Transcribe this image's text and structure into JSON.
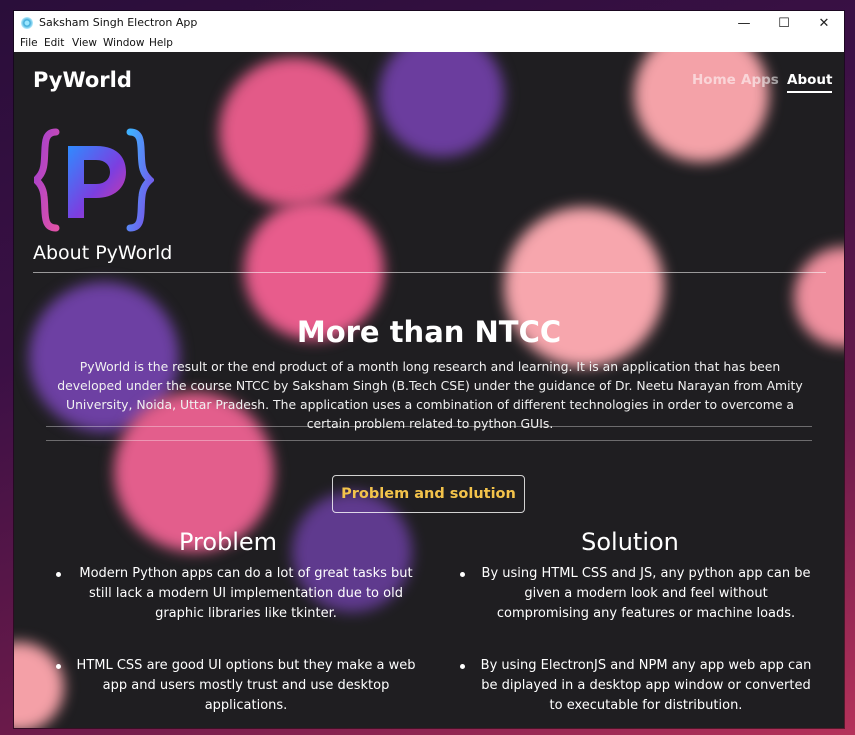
{
  "window": {
    "title": "Saksham Singh Electron App",
    "controls": {
      "minimize": "—",
      "maximize": "☐",
      "close": "✕"
    }
  },
  "menu": [
    "File",
    "Edit",
    "View",
    "Window",
    "Help"
  ],
  "nav": {
    "brand": "PyWorld",
    "links": [
      "Home",
      "Apps",
      "About"
    ],
    "active": "About"
  },
  "logo": {
    "icon": "pyworld-logo-icon",
    "text": "{P}"
  },
  "about_heading": "About PyWorld",
  "hero": {
    "title": "More than NTCC",
    "paragraph": "PyWorld is the result or the end product of a month long research and learning. It is an application that has been developed under the course NTCC by Saksham Singh (B.Tech CSE) under the guidance of Dr. Neetu Narayan from Amity University, Noida, Uttar Pradesh. The application uses a combination of different technologies in order to overcome a certain problem related to python GUIs."
  },
  "button": {
    "label": "Problem and solution"
  },
  "problem": {
    "heading": "Problem",
    "points": [
      "Modern Python apps can do a lot of great tasks but still lack a modern UI implementation due to old graphic libraries like tkinter.",
      "HTML CSS are good UI options but they make a web app and users mostly trust and use desktop applications."
    ]
  },
  "solution": {
    "heading": "Solution",
    "points": [
      "By using HTML CSS and JS, any python app can be given a modern look and feel without compromising any features or machine loads.",
      "By using ElectronJS and NPM any app web app can be diplayed in a desktop app window or converted to executable for distribution."
    ]
  },
  "colors": {
    "background": "#1f1e21",
    "accent_button_text": "#f3c34b",
    "bokeh_pink": "#e85d8a",
    "bokeh_peach": "#f6a3aa",
    "bokeh_purple": "#6b3d9e"
  }
}
